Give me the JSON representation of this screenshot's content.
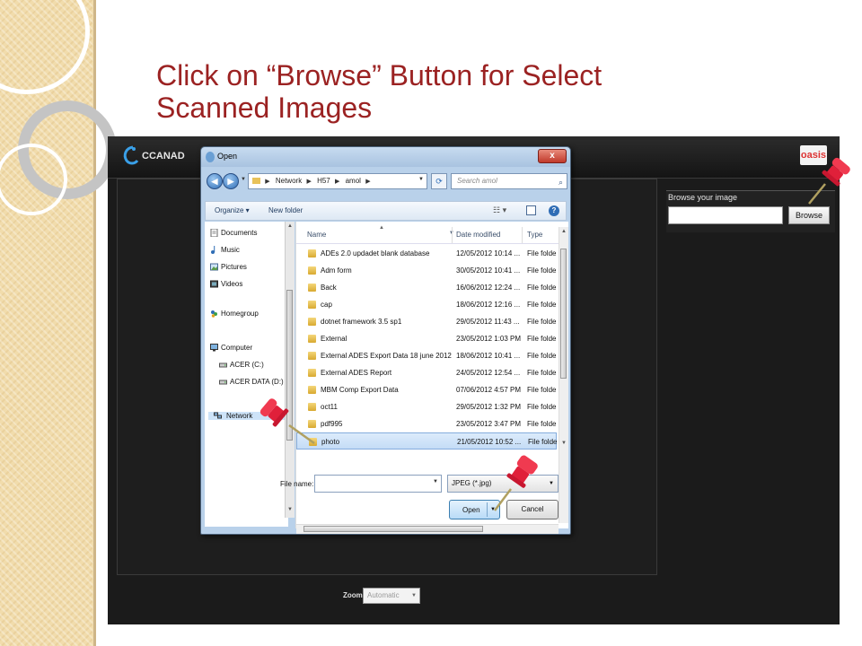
{
  "slide": {
    "title_line1": "Click on “Browse” Button for Select",
    "title_line2": "Scanned Images"
  },
  "app": {
    "name": "CCANAD",
    "partner_logo": "oasis",
    "browse_label": "Browse your image",
    "browse_button": "Browse",
    "zoom_label": "Zoom :",
    "zoom_value": "Automatic"
  },
  "dialog": {
    "title": "Open",
    "close_label": "x",
    "address": [
      "Network",
      "H57",
      "amol"
    ],
    "search_placeholder": "Search amol",
    "toolbar": {
      "organize": "Organize ▾",
      "new_folder": "New folder"
    },
    "nav_items": [
      {
        "label": "Documents",
        "icon": "documents-icon"
      },
      {
        "label": "Music",
        "icon": "music-icon"
      },
      {
        "label": "Pictures",
        "icon": "pictures-icon"
      },
      {
        "label": "Videos",
        "icon": "videos-icon"
      },
      {
        "label": "Homegroup",
        "icon": "homegroup-icon"
      },
      {
        "label": "Computer",
        "icon": "computer-icon"
      },
      {
        "label": "ACER (C:)",
        "icon": "drive-icon"
      },
      {
        "label": "ACER DATA (D:)",
        "icon": "drive-icon"
      },
      {
        "label": "Network",
        "icon": "network-icon"
      }
    ],
    "columns": {
      "name": "Name",
      "date": "Date modified",
      "type": "Type"
    },
    "files": [
      {
        "name": "ADEs 2.0 updadet blank database",
        "date": "12/05/2012 10:14 ...",
        "type": "File folder"
      },
      {
        "name": "Adm form",
        "date": "30/05/2012 10:41 ...",
        "type": "File folder"
      },
      {
        "name": "Back",
        "date": "16/06/2012 12:24 ...",
        "type": "File folder"
      },
      {
        "name": "cap",
        "date": "18/06/2012 12:16 ...",
        "type": "File folder"
      },
      {
        "name": "dotnet framework 3.5 sp1",
        "date": "29/05/2012 11:43 ...",
        "type": "File folder"
      },
      {
        "name": "External",
        "date": "23/05/2012 1:03 PM",
        "type": "File folder"
      },
      {
        "name": "External ADES Export Data 18 june 2012",
        "date": "18/06/2012 10:41 ...",
        "type": "File folder"
      },
      {
        "name": "External ADES Report",
        "date": "24/05/2012 12:54 ...",
        "type": "File folder"
      },
      {
        "name": "MBM Comp Export Data",
        "date": "07/06/2012 4:57 PM",
        "type": "File folder"
      },
      {
        "name": "oct11",
        "date": "29/05/2012 1:32 PM",
        "type": "File folder"
      },
      {
        "name": "pdf995",
        "date": "23/05/2012 3:47 PM",
        "type": "File folder"
      },
      {
        "name": "photo",
        "date": "21/05/2012 10:52 ...",
        "type": "File folder"
      }
    ],
    "selected_file": "photo",
    "filename_label": "File name:",
    "filename_value": "",
    "filetype_value": "JPEG (*.jpg)",
    "open_button": "Open",
    "cancel_button": "Cancel"
  },
  "colors": {
    "title": "#9b2222",
    "pin": "#e0203a",
    "app_bg": "#1b1b1b"
  }
}
